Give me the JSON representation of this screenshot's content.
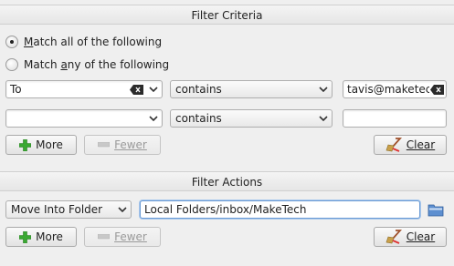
{
  "criteria": {
    "header": "Filter Criteria",
    "match_all_prefix": "",
    "match_all_ul": "M",
    "match_all_rest": "atch all of the following",
    "match_any_prefix": "Match ",
    "match_any_ul": "a",
    "match_any_rest": "ny of the following",
    "rows": [
      {
        "field": "To",
        "operator": "contains",
        "value": "tavis@maketec"
      },
      {
        "field": "",
        "operator": "contains",
        "value": ""
      }
    ],
    "more_label": "More",
    "fewer_label": "Fewer",
    "clear_label": "Clear"
  },
  "actions": {
    "header": "Filter Actions",
    "action": "Move Into Folder",
    "folder_path": "Local Folders/inbox/MakeTech",
    "more_label": "More",
    "fewer_label": "Fewer",
    "clear_label": "Clear"
  },
  "colors": {
    "add_icon": "#3aa832",
    "accent_folder": "#3b6fb5"
  }
}
